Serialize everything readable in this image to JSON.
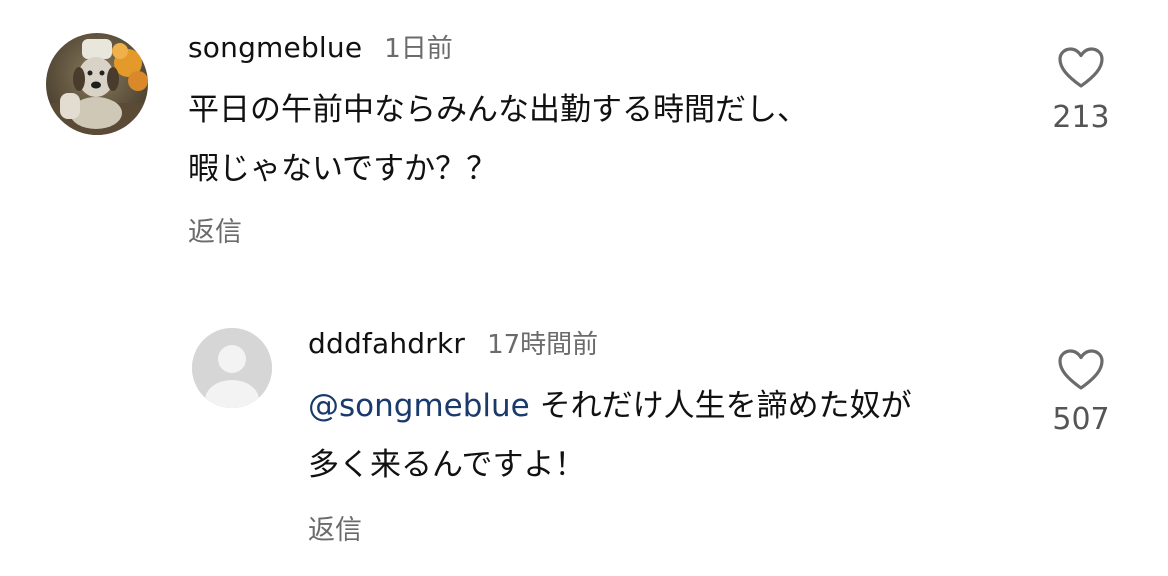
{
  "comments": [
    {
      "username": "songmeblue",
      "timestamp": "1日前",
      "text_line1": "平日の午前中ならみんな出勤する時間だし、",
      "text_line2": "暇じゃないですか？？",
      "reply_label": "返信",
      "likes": "213",
      "like_icon": "heart-outline-icon",
      "avatar": "profile-photo (dog figurine)"
    },
    {
      "username": "dddfahdrkr",
      "timestamp": "17時間前",
      "mention": "@songmeblue",
      "text_line1": " それだけ人生を諦めた奴が",
      "text_line2": "多く来るんですよ！",
      "reply_label": "返信",
      "likes": "507",
      "like_icon": "heart-outline-icon",
      "avatar": "default-avatar-icon"
    }
  ],
  "colors": {
    "text": "#111111",
    "muted": "#6b6b6b",
    "mention": "#1a3a6b",
    "avatar_default_bg": "#d6d6d6"
  }
}
